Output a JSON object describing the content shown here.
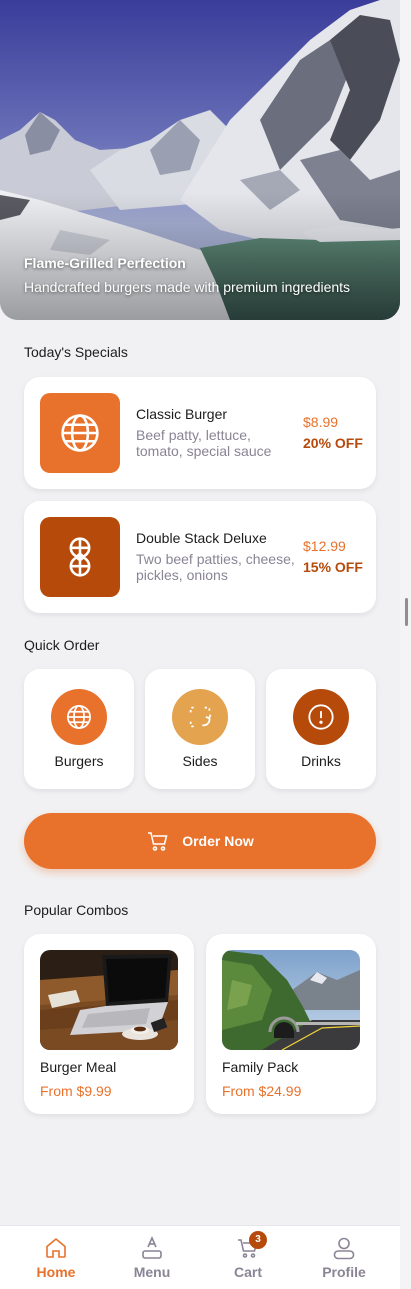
{
  "hero": {
    "title": "Flame-Grilled Perfection",
    "subtitle": "Handcrafted burgers made with premium ingredients"
  },
  "specials": {
    "heading": "Today's Specials",
    "items": [
      {
        "name": "Classic Burger",
        "description": "Beef patty, lettuce, tomato, special sauce",
        "price": "$8.99",
        "discount": "20% OFF",
        "icon": "globe-icon",
        "color": "#e8712b"
      },
      {
        "name": "Double Stack Deluxe",
        "description": "Two beef patties, cheese, pickles, onions",
        "price": "$12.99",
        "discount": "15% OFF",
        "icon": "stacked-burger-icon",
        "color": "#b54a0a"
      }
    ]
  },
  "quick_order": {
    "heading": "Quick Order",
    "items": [
      {
        "label": "Burgers",
        "icon": "globe-icon",
        "color": "#e8712b"
      },
      {
        "label": "Sides",
        "icon": "scan-rotate-icon",
        "color": "#e3a34f"
      },
      {
        "label": "Drinks",
        "icon": "alert-circle-icon",
        "color": "#b54a0a"
      }
    ]
  },
  "order_button": {
    "label": "Order Now",
    "icon": "cart-icon"
  },
  "combos": {
    "heading": "Popular Combos",
    "items": [
      {
        "name": "Burger Meal",
        "price": "From $9.99",
        "image": "laptop-coffee-photo"
      },
      {
        "name": "Family Pack",
        "price": "From $24.99",
        "image": "mountain-road-tunnel-photo"
      }
    ]
  },
  "nav": {
    "items": [
      {
        "label": "Home",
        "icon": "home-icon",
        "active": true
      },
      {
        "label": "Menu",
        "icon": "menu-icon",
        "active": false
      },
      {
        "label": "Cart",
        "icon": "cart-icon",
        "active": false
      },
      {
        "label": "Profile",
        "icon": "profile-icon",
        "active": false
      }
    ],
    "cart_count": "3"
  },
  "colors": {
    "primary": "#e8712b",
    "dark": "#b54a0a",
    "light": "#e3a34f",
    "muted_text": "#8a8494"
  }
}
